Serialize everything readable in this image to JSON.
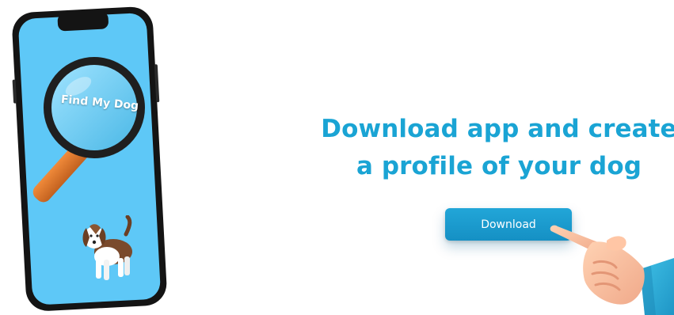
{
  "phone": {
    "app_name": "Find My Dog",
    "icons": [
      "magnifier-icon",
      "dog-illustration"
    ]
  },
  "headline": {
    "line1": "Download app and create",
    "line2": "a profile of your dog"
  },
  "cta": {
    "download_label": "Download"
  },
  "decor": {
    "hand": "pointing-hand-icon"
  },
  "colors": {
    "accent": "#1aa4d4",
    "button": "#1a9acd",
    "screen": "#5ec8f7",
    "phone_body": "#141414",
    "magnifier_handle": "#e0782c"
  }
}
